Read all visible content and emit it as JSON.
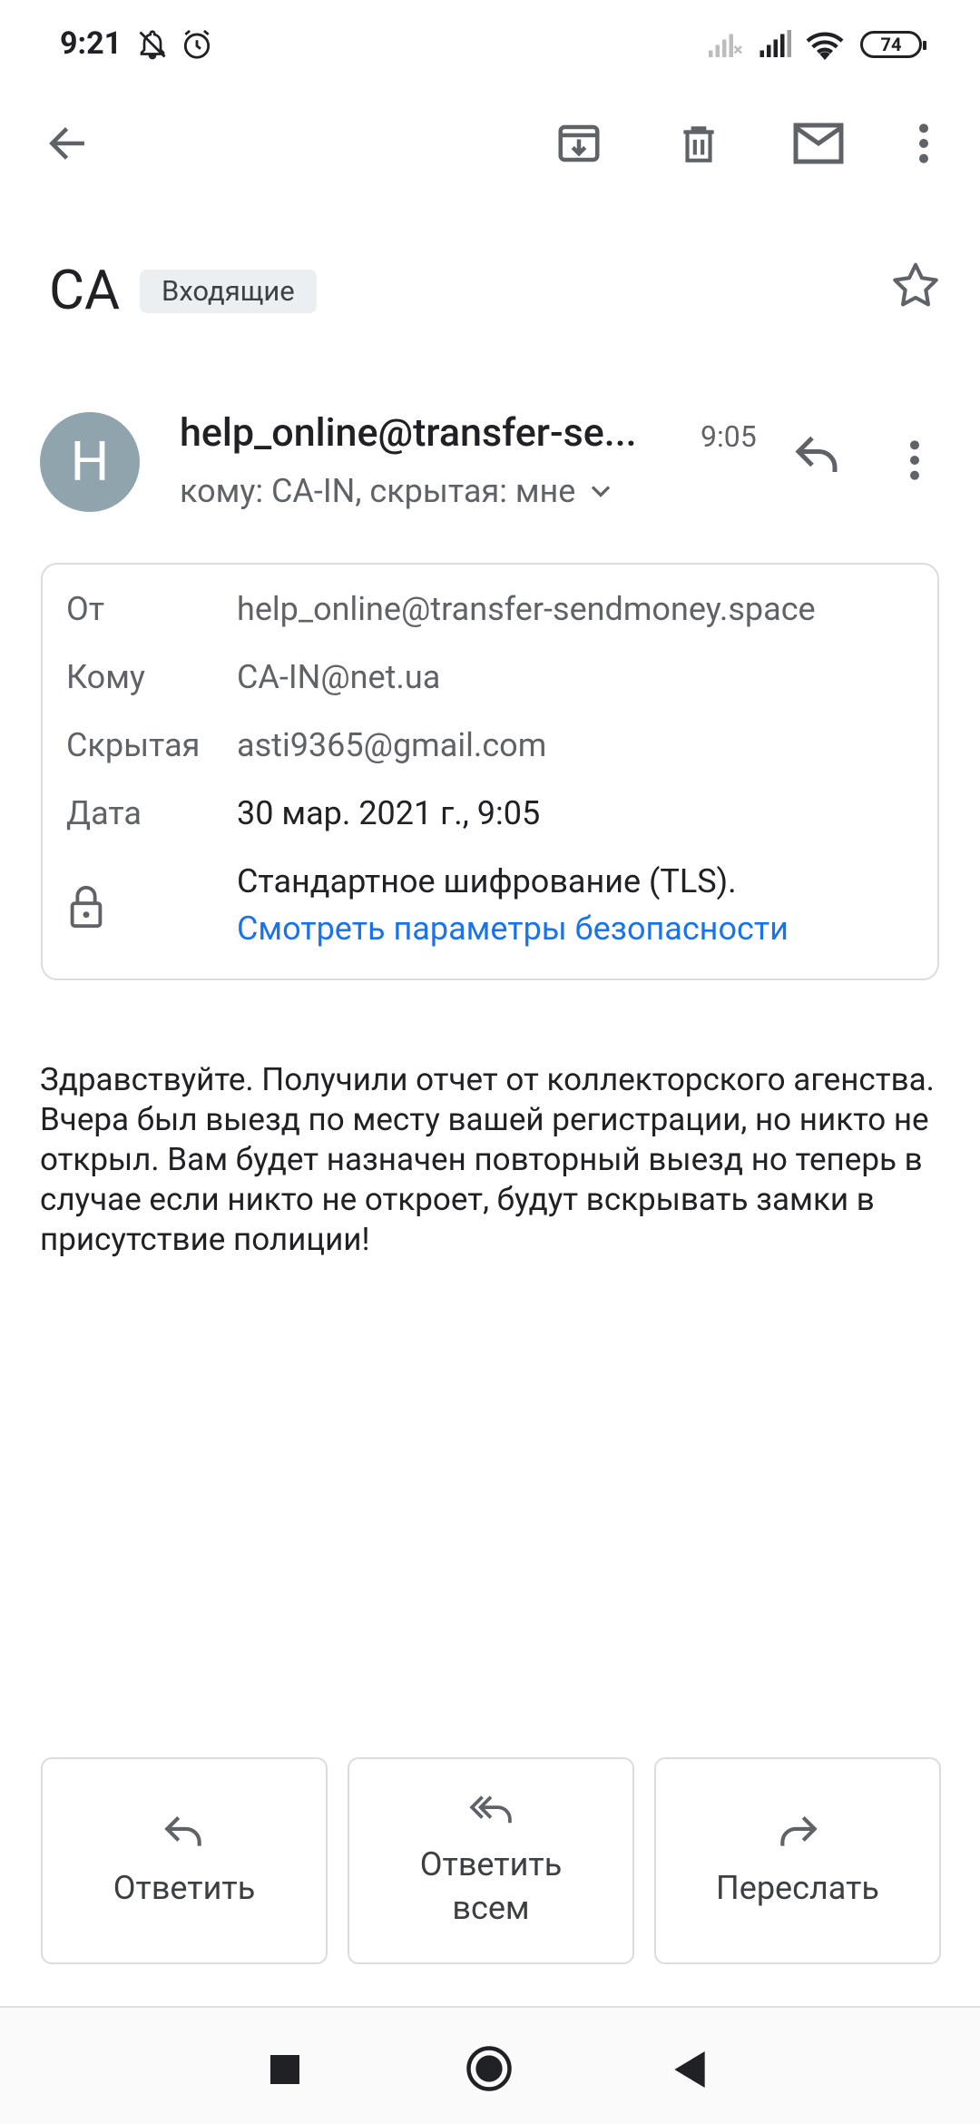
{
  "status_bar": {
    "time": "9:21",
    "battery": "74",
    "icons": [
      "bell-off-icon",
      "alarm-icon",
      "signal-weak-icon",
      "signal-icon",
      "wifi-icon",
      "battery-icon"
    ]
  },
  "toolbar": {
    "icons": [
      "back-arrow-icon",
      "archive-icon",
      "trash-icon",
      "mark-unread-icon",
      "more-vert-icon"
    ]
  },
  "email": {
    "subject": "CA",
    "label": "Входящие",
    "sender_initial": "H",
    "sender": "help_online@transfer-se...",
    "time": "9:05",
    "recipients": "кому: CA-IN, скрытая: мне"
  },
  "details": {
    "from_label": "От",
    "from_value": "help_online@transfer-sendmoney.space",
    "to_label": "Кому",
    "to_value": "CA-IN@net.ua",
    "bcc_label": "Скрытая",
    "bcc_value": "asti9365@gmail.com",
    "date_label": "Дата",
    "date_value": "30 мар. 2021 г., 9:05",
    "encryption": "Стандартное шифрование (TLS).",
    "security_link": "Смотреть параметры безопасности"
  },
  "body": {
    "text": "Здравствуйте. Получили отчет от коллекторского агенства. Вчера был выезд по месту вашей регистрации, но никто не открыл. Вам будет назначен повторный выезд но теперь в случае если никто не откроет, будут вскрывать замки в присутствие полиции!"
  },
  "actions": {
    "reply": "Ответить",
    "reply_all_line1": "Ответить",
    "reply_all_line2": "всем",
    "forward": "Переслать"
  },
  "colors": {
    "avatar": "#90a4ae",
    "link": "#1a73e8",
    "chip": "#eceff1"
  }
}
